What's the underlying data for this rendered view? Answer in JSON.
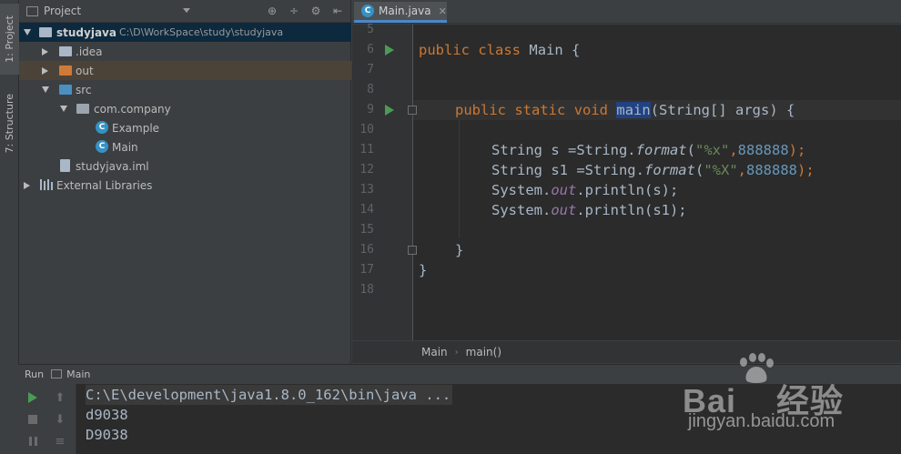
{
  "side_tabs": {
    "project": "1: Project",
    "structure": "7: Structure"
  },
  "project_panel": {
    "title": "Project",
    "tree": [
      {
        "label": "studyjava",
        "path": "C:\\D\\WorkSpace\\study\\studyjava",
        "icon": "folder-icon"
      },
      {
        "label": ".idea",
        "icon": "folder-icon"
      },
      {
        "label": "out",
        "icon": "folder-icon"
      },
      {
        "label": "src",
        "icon": "folder-icon"
      },
      {
        "label": "com.company",
        "icon": "package-icon"
      },
      {
        "label": "Example",
        "icon": "class-icon"
      },
      {
        "label": "Main",
        "icon": "class-icon"
      },
      {
        "label": "studyjava.iml",
        "icon": "file-icon"
      },
      {
        "label": "External Libraries",
        "icon": "library-icon"
      }
    ]
  },
  "editor": {
    "tab_label": "Main.java",
    "line_numbers": [
      "5",
      "6",
      "7",
      "8",
      "9",
      "10",
      "11",
      "12",
      "13",
      "14",
      "15",
      "16",
      "17",
      "18"
    ],
    "code": {
      "class_decl": {
        "kw1": "public",
        "kw2": "class",
        "name": "Main {"
      },
      "method_decl": {
        "kw1": "public",
        "kw2": "static",
        "kw3": "void",
        "name": "main",
        "rest": "(String[] args) {"
      },
      "line11": {
        "a": "String s =String.",
        "m": "format",
        "p": "(",
        "s": "\"%x\"",
        "c": ",",
        "n": "888888",
        "e": ");"
      },
      "line12": {
        "a": "String s1 =String.",
        "m": "format",
        "p": "(",
        "s": "\"%X\"",
        "c": ",",
        "n": "888888",
        "e": ");"
      },
      "line13": {
        "a": "System.",
        "f": "out",
        "b": ".println(s);"
      },
      "line14": {
        "a": "System.",
        "f": "out",
        "b": ".println(s1);"
      },
      "close_method": "}",
      "close_class": "}"
    }
  },
  "breadcrumbs": [
    "Main",
    "main()"
  ],
  "run_panel": {
    "label": "Run",
    "config": "Main",
    "output": [
      "C:\\E\\development\\java1.8.0_162\\bin\\java ...",
      "d9038",
      "D9038"
    ]
  },
  "watermark": {
    "brand": "Bai",
    "brand2": "经验",
    "url": "jingyan.baidu.com"
  },
  "colors": {
    "keyword": "#cc7832",
    "string": "#6a8759",
    "number": "#6897bb",
    "field": "#9876aa",
    "selection": "#214283",
    "run_green": "#499c54"
  }
}
